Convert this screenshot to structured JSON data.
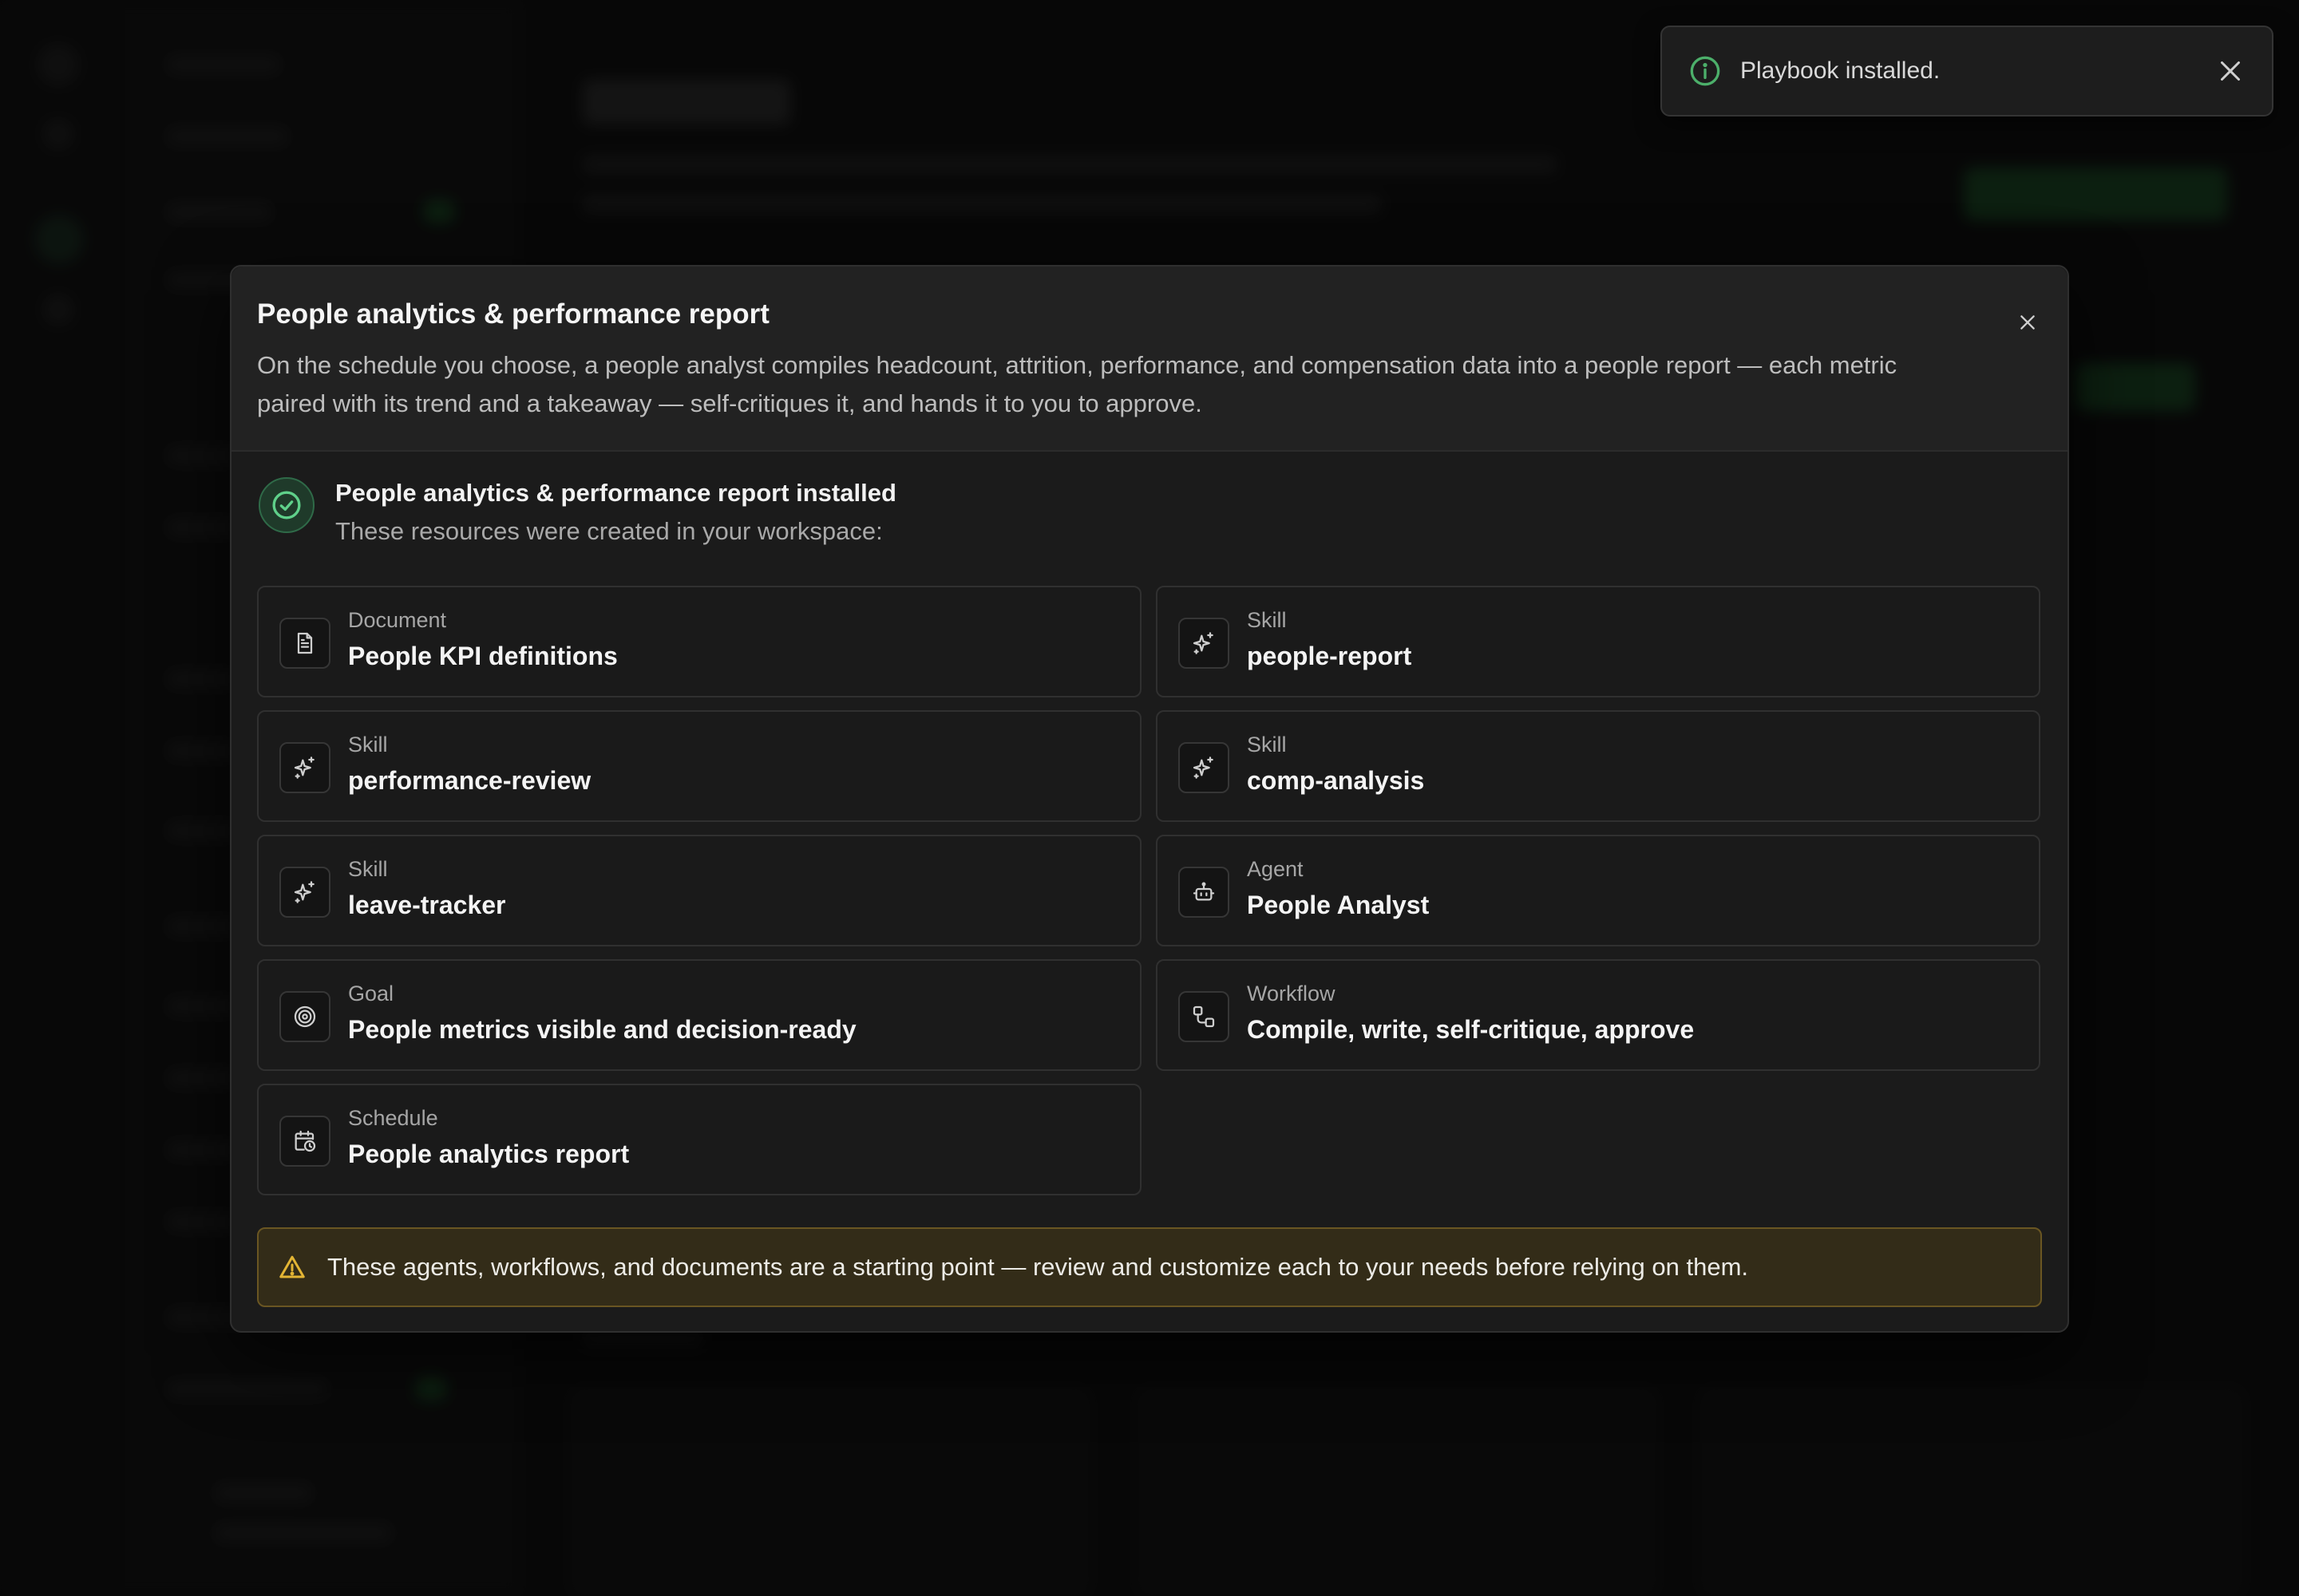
{
  "toast": {
    "message": "Playbook installed.",
    "icon": "info-icon",
    "close_icon": "close-icon",
    "accent": "#4caf6a"
  },
  "modal": {
    "title": "People analytics & performance report",
    "description": "On the schedule you choose, a people analyst compiles headcount, attrition, performance, and compensation data into a people report — each metric paired with its trend and a takeaway — self-critiques it, and hands it to you to approve.",
    "close_icon": "close-icon",
    "success": {
      "icon": "check-circle-icon",
      "title": "People analytics & performance report installed",
      "subtitle": "These resources were created in your workspace:",
      "accent": "#5fd08a"
    },
    "resources": [
      {
        "type": "Document",
        "name": "People KPI definitions",
        "icon": "document-icon"
      },
      {
        "type": "Skill",
        "name": "people-report",
        "icon": "sparkle-icon"
      },
      {
        "type": "Skill",
        "name": "performance-review",
        "icon": "sparkle-icon"
      },
      {
        "type": "Skill",
        "name": "comp-analysis",
        "icon": "sparkle-icon"
      },
      {
        "type": "Skill",
        "name": "leave-tracker",
        "icon": "sparkle-icon"
      },
      {
        "type": "Agent",
        "name": "People Analyst",
        "icon": "robot-icon"
      },
      {
        "type": "Goal",
        "name": "People metrics visible and decision-ready",
        "icon": "target-icon"
      },
      {
        "type": "Workflow",
        "name": "Compile, write, self-critique, approve",
        "icon": "workflow-icon"
      },
      {
        "type": "Schedule",
        "name": "People analytics report",
        "icon": "calendar-clock-icon"
      }
    ],
    "warning": {
      "icon": "warning-icon",
      "text": "These agents, workflows, and documents are a starting point — review and customize each to your needs before relying on them.",
      "accent": "#e3b534"
    }
  }
}
